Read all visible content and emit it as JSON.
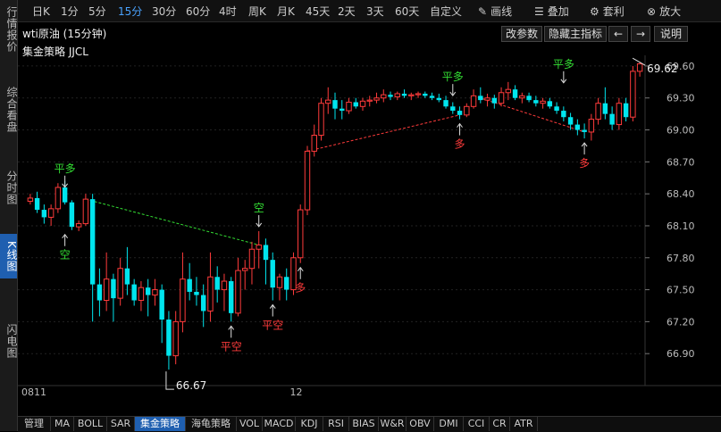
{
  "sidebar": {
    "items": [
      {
        "label": "行情报价",
        "active": false
      },
      {
        "label": "综合看盘",
        "active": false
      },
      {
        "label": "分时图",
        "active": false
      },
      {
        "label": "K线图",
        "active": true
      },
      {
        "label": "闪电图",
        "active": false
      }
    ]
  },
  "toolbar": {
    "periods": [
      "日K",
      "1分",
      "5分",
      "15分",
      "30分",
      "60分",
      "4时",
      "周K",
      "月K",
      "45天",
      "2天",
      "3天",
      "60天",
      "自定义"
    ],
    "active_period": "15分",
    "tools": [
      {
        "label": "画线",
        "icon": "pencil-icon"
      },
      {
        "label": "叠加",
        "icon": "layers-icon"
      },
      {
        "label": "套利",
        "icon": "arbitrage-icon"
      },
      {
        "label": "放大",
        "icon": "zoom-icon"
      }
    ]
  },
  "subbar": {
    "title": "wti原油 (15分钟)",
    "strategy_label": "集金策略 JJCL",
    "btn_params": "改参数",
    "btn_hide": "隐藏主指标",
    "btn_left": "←",
    "btn_right": "→",
    "btn_help": "说明"
  },
  "bottombar": {
    "tabs": [
      "管理",
      "MA",
      "BOLL",
      "SAR",
      "集金策略",
      "海龟策略",
      "VOL",
      "MACD",
      "KDJ",
      "RSI",
      "BIAS",
      "W&R",
      "OBV",
      "DMI",
      "CCI",
      "CR",
      "ATR"
    ],
    "active_tab": "集金策略"
  },
  "chart_data": {
    "type": "candlestick",
    "ylim": [
      66.6,
      69.7
    ],
    "y_ticks": [
      "69.60",
      "69.30",
      "69.00",
      "68.70",
      "68.40",
      "68.10",
      "67.80",
      "67.50",
      "67.20",
      "66.90"
    ],
    "x_labels": [
      {
        "label": "0811",
        "index": 0
      },
      {
        "label": "12",
        "index": 38
      }
    ],
    "colors": {
      "up": "#ff3b3b",
      "down": "#00e5ee",
      "long": "#ff3b3b",
      "short": "#33dd33"
    },
    "candles": [
      [
        68.33,
        68.4,
        68.3,
        68.36
      ],
      [
        68.36,
        68.42,
        68.22,
        68.25
      ],
      [
        68.25,
        68.3,
        68.12,
        68.18
      ],
      [
        68.18,
        68.3,
        68.1,
        68.26
      ],
      [
        68.26,
        68.5,
        68.22,
        68.46
      ],
      [
        68.46,
        68.52,
        68.3,
        68.32
      ],
      [
        68.32,
        68.34,
        68.06,
        68.09
      ],
      [
        68.09,
        68.15,
        68.05,
        68.12
      ],
      [
        68.12,
        68.4,
        68.1,
        68.35
      ],
      [
        68.35,
        68.4,
        67.2,
        67.55
      ],
      [
        67.55,
        67.7,
        67.25,
        67.4
      ],
      [
        67.4,
        67.85,
        67.3,
        67.6
      ],
      [
        67.6,
        67.65,
        67.2,
        67.42
      ],
      [
        67.42,
        67.8,
        67.35,
        67.7
      ],
      [
        67.7,
        67.9,
        67.45,
        67.55
      ],
      [
        67.55,
        67.6,
        67.35,
        67.4
      ],
      [
        67.4,
        67.58,
        67.3,
        67.52
      ],
      [
        67.52,
        67.6,
        67.25,
        67.45
      ],
      [
        67.45,
        67.6,
        67.35,
        67.5
      ],
      [
        67.5,
        67.55,
        67.0,
        67.22
      ],
      [
        67.22,
        67.3,
        66.75,
        66.88
      ],
      [
        66.88,
        67.3,
        66.8,
        67.2
      ],
      [
        67.2,
        67.85,
        67.1,
        67.6
      ],
      [
        67.6,
        67.75,
        67.4,
        67.48
      ],
      [
        67.48,
        67.62,
        67.35,
        67.45
      ],
      [
        67.45,
        67.55,
        67.15,
        67.3
      ],
      [
        67.3,
        67.85,
        67.2,
        67.62
      ],
      [
        67.62,
        67.72,
        67.38,
        67.5
      ],
      [
        67.5,
        67.65,
        67.3,
        67.58
      ],
      [
        67.58,
        67.62,
        67.2,
        67.28
      ],
      [
        67.28,
        67.8,
        67.25,
        67.68
      ],
      [
        67.68,
        67.78,
        67.5,
        67.7
      ],
      [
        67.7,
        67.95,
        67.55,
        67.88
      ],
      [
        67.88,
        68.05,
        67.7,
        67.92
      ],
      [
        67.92,
        67.98,
        67.55,
        67.78
      ],
      [
        67.78,
        67.85,
        67.4,
        67.52
      ],
      [
        67.52,
        67.65,
        67.4,
        67.62
      ],
      [
        67.62,
        67.7,
        67.4,
        67.5
      ],
      [
        67.5,
        67.85,
        67.45,
        67.8
      ],
      [
        67.8,
        68.3,
        67.75,
        68.25
      ],
      [
        68.25,
        68.85,
        68.2,
        68.8
      ],
      [
        68.8,
        69.05,
        68.75,
        68.95
      ],
      [
        68.95,
        69.3,
        68.9,
        69.25
      ],
      [
        69.25,
        69.4,
        69.15,
        69.28
      ],
      [
        69.28,
        69.35,
        69.1,
        69.2
      ],
      [
        69.2,
        69.28,
        69.1,
        69.18
      ],
      [
        69.18,
        69.3,
        69.15,
        69.26
      ],
      [
        69.26,
        69.3,
        69.2,
        69.22
      ],
      [
        69.22,
        69.3,
        69.18,
        69.27
      ],
      [
        69.27,
        69.32,
        69.22,
        69.28
      ],
      [
        69.28,
        69.35,
        69.25,
        69.3
      ],
      [
        69.3,
        69.38,
        69.26,
        69.33
      ],
      [
        69.33,
        69.36,
        69.28,
        69.31
      ],
      [
        69.31,
        69.36,
        69.28,
        69.34
      ],
      [
        69.34,
        69.38,
        69.3,
        69.32
      ],
      [
        69.32,
        69.35,
        69.28,
        69.33
      ],
      [
        69.33,
        69.36,
        69.3,
        69.34
      ],
      [
        69.34,
        69.36,
        69.3,
        69.32
      ],
      [
        69.32,
        69.35,
        69.28,
        69.3
      ],
      [
        69.3,
        69.34,
        69.26,
        69.28
      ],
      [
        69.28,
        69.32,
        69.2,
        69.22
      ],
      [
        69.22,
        69.26,
        69.15,
        69.18
      ],
      [
        69.18,
        69.22,
        69.1,
        69.14
      ],
      [
        69.14,
        69.25,
        69.12,
        69.22
      ],
      [
        69.22,
        69.38,
        69.2,
        69.32
      ],
      [
        69.32,
        69.4,
        69.25,
        69.28
      ],
      [
        69.28,
        69.34,
        69.22,
        69.3
      ],
      [
        69.3,
        69.33,
        69.2,
        69.25
      ],
      [
        69.25,
        69.4,
        69.22,
        69.35
      ],
      [
        69.35,
        69.45,
        69.28,
        69.38
      ],
      [
        69.38,
        69.42,
        69.28,
        69.3
      ],
      [
        69.3,
        69.35,
        69.25,
        69.32
      ],
      [
        69.32,
        69.35,
        69.26,
        69.28
      ],
      [
        69.28,
        69.32,
        69.22,
        69.25
      ],
      [
        69.25,
        69.3,
        69.2,
        69.27
      ],
      [
        69.27,
        69.3,
        69.2,
        69.22
      ],
      [
        69.22,
        69.26,
        69.15,
        69.18
      ],
      [
        69.18,
        69.22,
        69.08,
        69.12
      ],
      [
        69.12,
        69.16,
        69.0,
        69.05
      ],
      [
        69.05,
        69.1,
        68.95,
        69.0
      ],
      [
        69.0,
        69.06,
        68.92,
        68.98
      ],
      [
        68.98,
        69.15,
        68.9,
        69.1
      ],
      [
        69.1,
        69.3,
        69.05,
        69.25
      ],
      [
        69.25,
        69.4,
        69.1,
        69.15
      ],
      [
        69.15,
        69.22,
        69.0,
        69.05
      ],
      [
        69.05,
        69.3,
        69.0,
        69.25
      ],
      [
        69.25,
        69.3,
        69.08,
        69.12
      ],
      [
        69.12,
        69.6,
        69.08,
        69.55
      ],
      [
        69.55,
        69.64,
        69.5,
        69.62
      ]
    ],
    "signal_lines": [
      {
        "from": 8,
        "to": 33,
        "signal": "short"
      },
      {
        "from": 40,
        "to": 62,
        "signal": "long"
      },
      {
        "from": 64,
        "to": 80,
        "signal": "long"
      }
    ],
    "annotations": [
      {
        "index": 5,
        "price": 68.42,
        "text": "平多",
        "signal": "short",
        "position": "above"
      },
      {
        "index": 5,
        "price": 68.06,
        "text": "空",
        "signal": "short",
        "position": "below"
      },
      {
        "index": 33,
        "price": 68.05,
        "text": "空",
        "signal": "short",
        "position": "above"
      },
      {
        "index": 29,
        "price": 67.2,
        "text": "平空",
        "signal": "long",
        "position": "below"
      },
      {
        "index": 35,
        "price": 67.4,
        "text": "平空",
        "signal": "long",
        "position": "below"
      },
      {
        "index": 39,
        "price": 67.75,
        "text": "多",
        "signal": "long",
        "position": "below"
      },
      {
        "index": 61,
        "price": 69.28,
        "text": "平多",
        "signal": "short",
        "position": "above"
      },
      {
        "index": 62,
        "price": 69.1,
        "text": "多",
        "signal": "long",
        "position": "below"
      },
      {
        "index": 77,
        "price": 69.4,
        "text": "平多",
        "signal": "short",
        "position": "above"
      },
      {
        "index": 80,
        "price": 68.92,
        "text": "多",
        "signal": "long",
        "position": "below"
      }
    ],
    "low_marker": {
      "index": 20,
      "value": "66.67"
    },
    "last_marker": {
      "index": 88,
      "value": "69.62"
    }
  }
}
